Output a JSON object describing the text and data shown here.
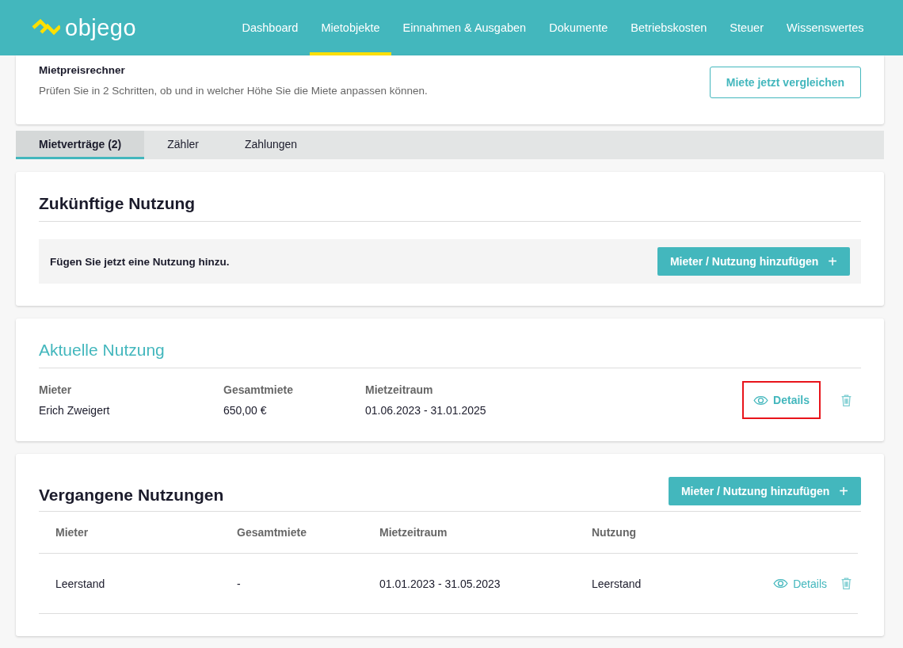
{
  "header": {
    "logo": "objego",
    "nav": [
      {
        "label": "Dashboard",
        "selected": false
      },
      {
        "label": "Mietobjekte",
        "selected": true
      },
      {
        "label": "Einnahmen & Ausgaben",
        "selected": false
      },
      {
        "label": "Dokumente",
        "selected": false
      },
      {
        "label": "Betriebskosten",
        "selected": false
      },
      {
        "label": "Steuer",
        "selected": false
      },
      {
        "label": "Wissenswertes",
        "selected": false
      }
    ]
  },
  "mietpreisrechner": {
    "title": "Mietpreisrechner",
    "text": "Prüfen Sie in 2 Schritten, ob und in welcher Höhe Sie die Miete anpassen können.",
    "button": "Miete jetzt vergleichen"
  },
  "tabs": [
    {
      "label": "Mietverträge (2)",
      "selected": true
    },
    {
      "label": "Zähler",
      "selected": false
    },
    {
      "label": "Zahlungen",
      "selected": false
    }
  ],
  "future": {
    "title": "Zukünftige Nutzung",
    "notice": "Fügen Sie jetzt eine Nutzung hinzu.",
    "button": "Mieter / Nutzung hinzufügen",
    "button_icon": "+"
  },
  "current": {
    "title": "Aktuelle Nutzung",
    "columns": [
      "Mieter",
      "Gesamtmiete",
      "Mietzeitraum"
    ],
    "rows": [
      {
        "cells": [
          "Erich Zweigert",
          "650,00 €",
          "01.06.2023 - 31.01.2025"
        ],
        "details": "Details",
        "highlighted": true
      }
    ]
  },
  "past": {
    "title": "Vergangene Nutzungen",
    "button": "Mieter / Nutzung hinzufügen",
    "button_icon": "+",
    "columns": [
      "Mieter",
      "Gesamtmiete",
      "Mietzeitraum",
      "Nutzung"
    ],
    "rows": [
      {
        "cells": [
          "Leerstand",
          "-",
          "01.01.2023 - 31.05.2023",
          "Leerstand"
        ],
        "details": "Details",
        "highlighted": false
      }
    ]
  }
}
